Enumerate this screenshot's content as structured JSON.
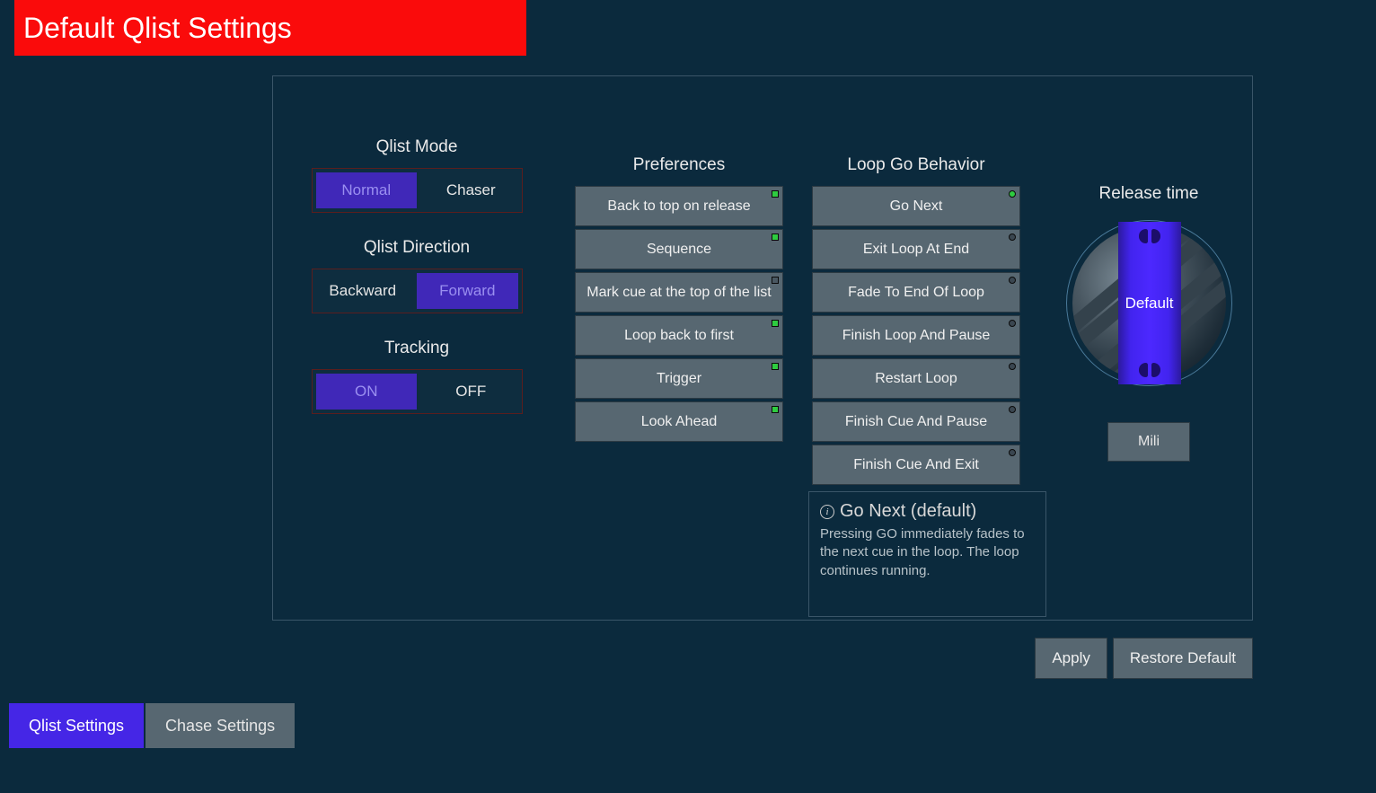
{
  "title": "Default Qlist Settings",
  "qlist_mode": {
    "label": "Qlist Mode",
    "options": [
      "Normal",
      "Chaser"
    ],
    "active": 0
  },
  "qlist_direction": {
    "label": "Qlist Direction",
    "options": [
      "Backward",
      "Forward"
    ],
    "active": 1
  },
  "tracking": {
    "label": "Tracking",
    "options": [
      "ON",
      "OFF"
    ],
    "active": 0
  },
  "preferences": {
    "label": "Preferences",
    "items": [
      {
        "label": "Back to top on release",
        "on": true
      },
      {
        "label": "Sequence",
        "on": true
      },
      {
        "label": "Mark cue at the top of the list",
        "on": false
      },
      {
        "label": "Loop back to first",
        "on": true
      },
      {
        "label": "Trigger",
        "on": true
      },
      {
        "label": "Look Ahead",
        "on": true
      }
    ]
  },
  "loop_go": {
    "label": "Loop Go Behavior",
    "items": [
      {
        "label": "Go Next"
      },
      {
        "label": "Exit Loop At End"
      },
      {
        "label": "Fade To End Of Loop"
      },
      {
        "label": "Finish Loop And Pause"
      },
      {
        "label": "Restart Loop"
      },
      {
        "label": "Finish Cue And Pause"
      },
      {
        "label": "Finish Cue And Exit"
      }
    ],
    "selected": 0
  },
  "info": {
    "title": "Go Next (default)",
    "body": "Pressing GO immediately fades to the next cue in the loop. The loop continues running."
  },
  "release_time": {
    "label": "Release time",
    "value": "Default",
    "unit_button": "Mili"
  },
  "actions": {
    "apply": "Apply",
    "restore": "Restore Default"
  },
  "tabs": {
    "items": [
      "Qlist Settings",
      "Chase Settings"
    ],
    "active": 0
  }
}
